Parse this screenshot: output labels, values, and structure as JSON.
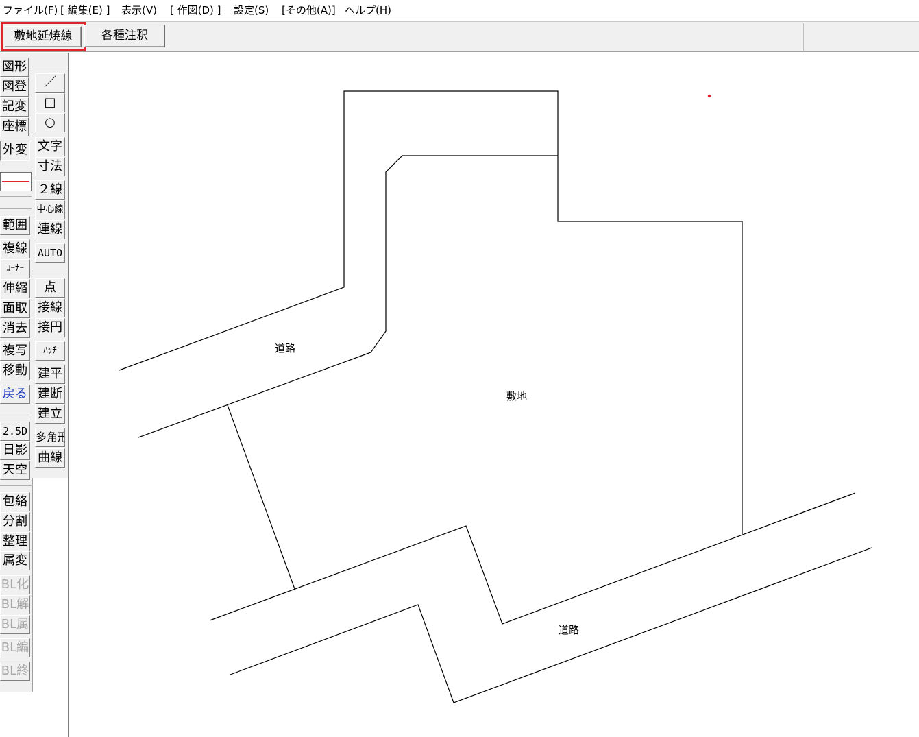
{
  "menubar": {
    "items": [
      {
        "label": "ファイル(F)"
      },
      {
        "label": "[ 編集(E) ]"
      },
      {
        "label": "表示(V)"
      },
      {
        "label": "[ 作図(D) ]"
      },
      {
        "label": "設定(S)"
      },
      {
        "label": "[その他(A)]"
      },
      {
        "label": "ヘルプ(H)"
      }
    ]
  },
  "toolbar": {
    "shikichi_label": "敷地延焼線",
    "chushaku_label": "各種注釈"
  },
  "left_tools": {
    "zukei": "図形",
    "zuto": "図登",
    "kihen": "記変",
    "zahyo": "座標",
    "gaihen": "外変",
    "hani": "範囲",
    "fukusen": "複線",
    "corner": "ｺｰﾅｰ",
    "shinshuku": "伸縮",
    "mentori": "面取",
    "shokyo": "消去",
    "fukusha": "複写",
    "ido": "移動",
    "modoru": "戻る",
    "d25": "2.5D",
    "nichiei": "日影",
    "tenku": "天空",
    "horaku": "包絡",
    "bunkatsu": "分割",
    "seiri": "整理",
    "zokuhen": "属変",
    "bl_ka": "BL化",
    "bl_kai": "BL解",
    "bl_zoku": "BL属",
    "bl_hen": "BL編",
    "bl_shu": "BL終"
  },
  "mid_tools": {
    "line": "／",
    "rect": "□",
    "circle": "○",
    "moji": "文字",
    "sunpo": "寸法",
    "nisen": "２線",
    "chushin": "中心線",
    "rensen": "連線",
    "auto": "AUTO",
    "ten": "点",
    "sessen": "接線",
    "seien": "接円",
    "hatch": "ﾊｯﾁ",
    "kenhei": "建平",
    "kendan": "建断",
    "kenritsu": "建立",
    "takakukei": "多角形",
    "kyokusen": "曲線"
  },
  "drawing": {
    "labels": {
      "road_top": "道路",
      "site": "敷地",
      "road_bottom": "道路"
    },
    "line_color": "#000000",
    "point_color": "#e0242e"
  }
}
